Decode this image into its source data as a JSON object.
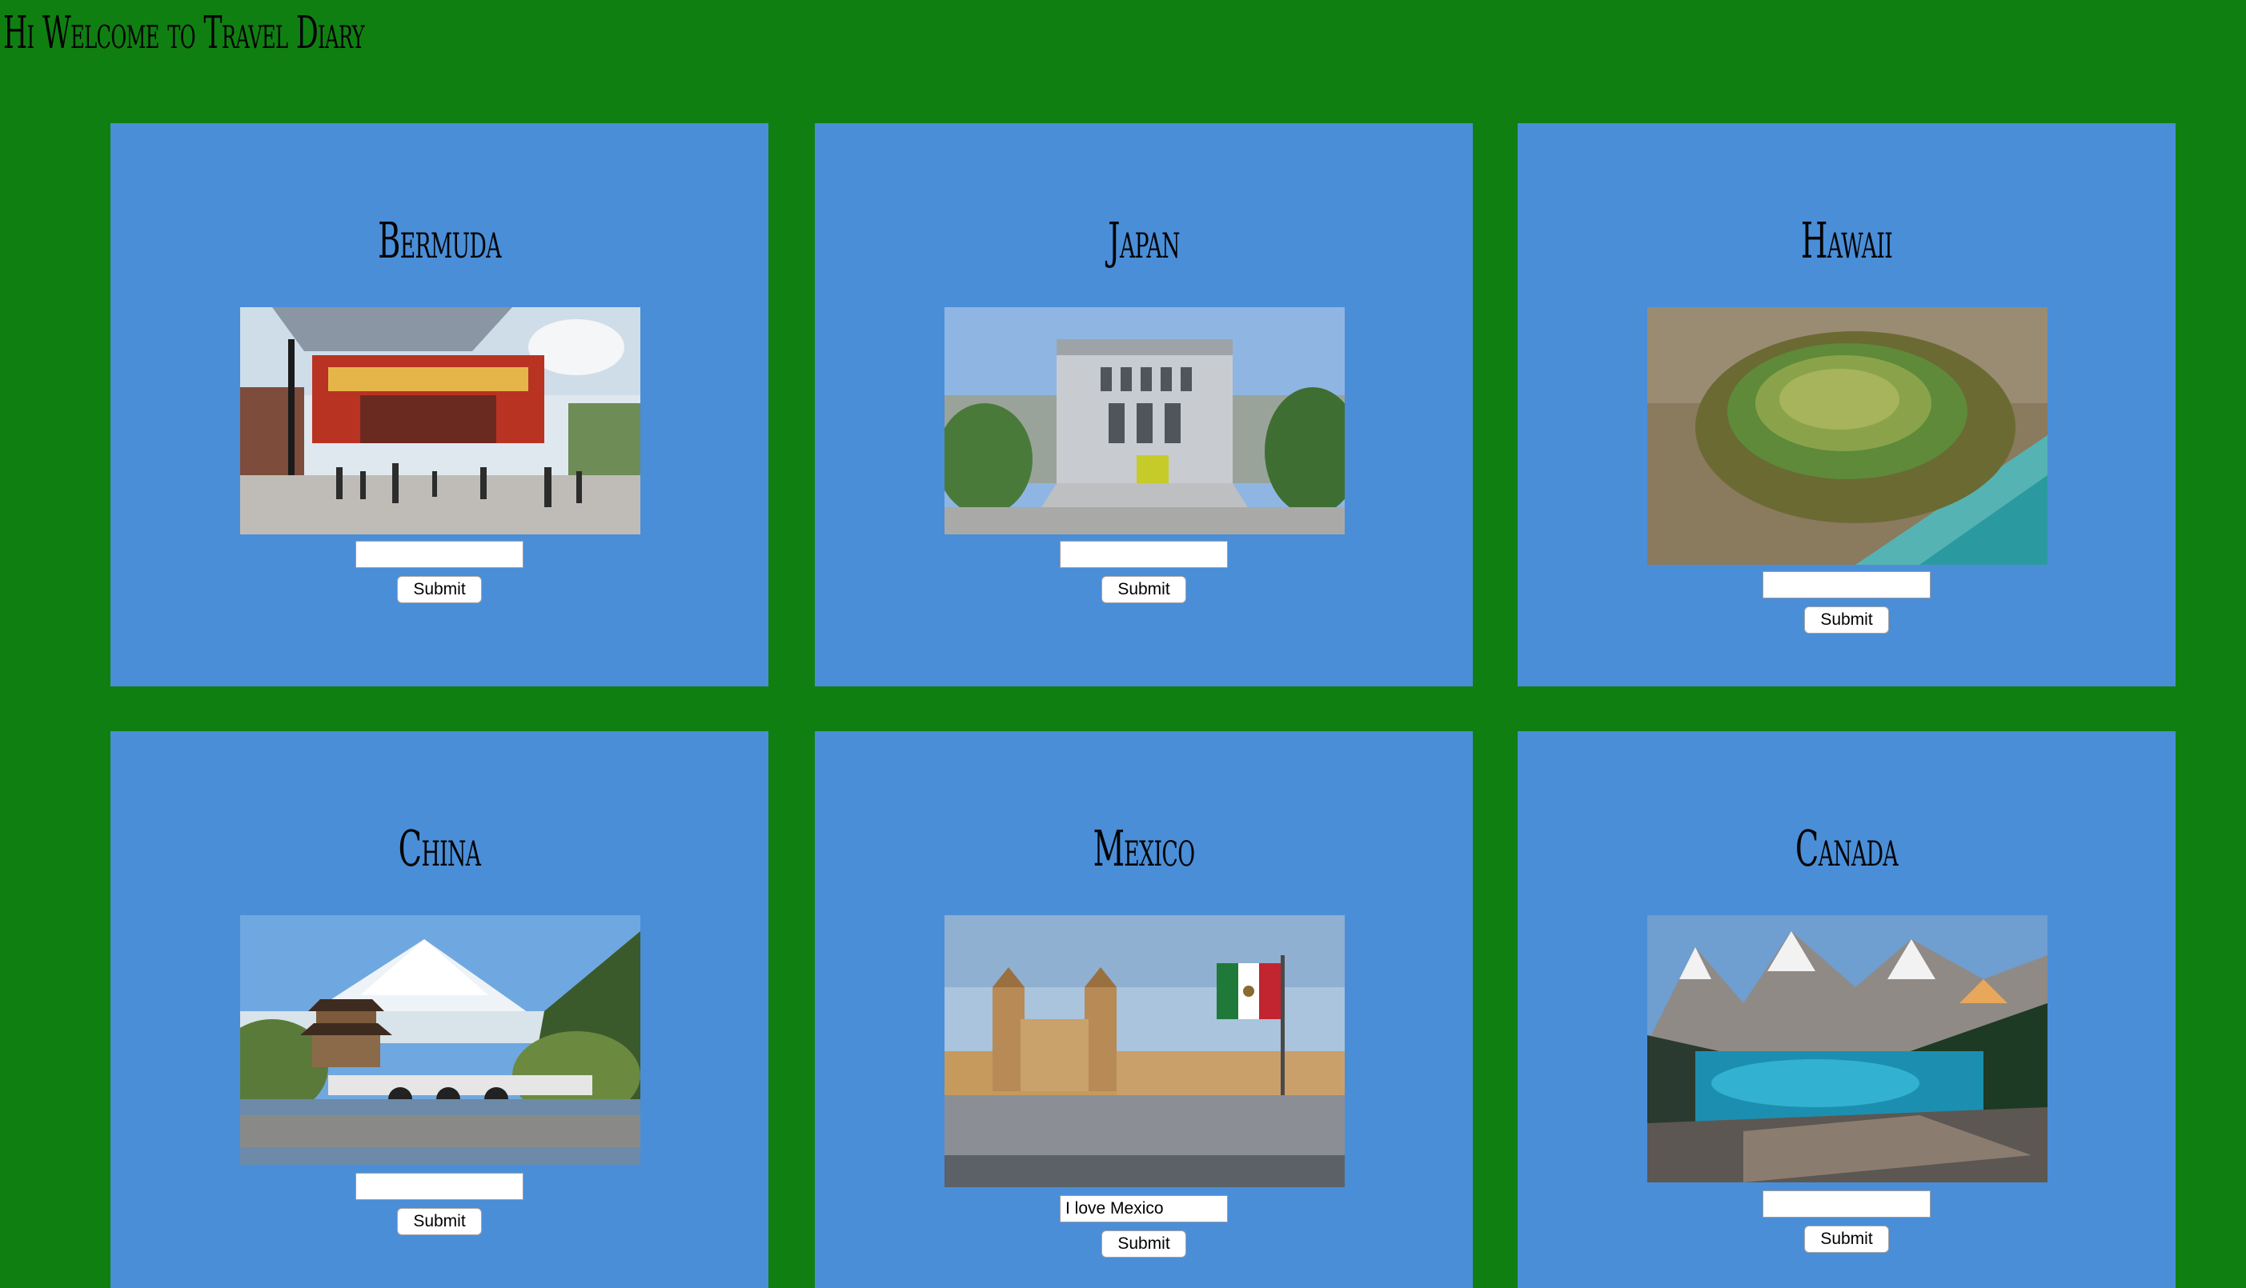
{
  "header": {
    "title": "Hi Welcome to Travel Diary"
  },
  "destinations": [
    {
      "name": "Bermuda",
      "photo_icon": "street-scene-photo",
      "input_value": "",
      "submit_label": "Submit"
    },
    {
      "name": "Japan",
      "photo_icon": "museum-building-photo",
      "input_value": "",
      "submit_label": "Submit"
    },
    {
      "name": "Hawaii",
      "photo_icon": "volcanic-crater-photo",
      "input_value": "",
      "submit_label": "Submit"
    },
    {
      "name": "China",
      "photo_icon": "pagoda-lake-photo",
      "input_value": "",
      "submit_label": "Submit"
    },
    {
      "name": "Mexico",
      "photo_icon": "cathedral-plaza-flag-photo",
      "input_value": "I love Mexico",
      "submit_label": "Submit"
    },
    {
      "name": "Canada",
      "photo_icon": "mountain-lake-photo",
      "input_value": "",
      "submit_label": "Submit"
    }
  ],
  "colors": {
    "page_background": "#107f12",
    "card_background": "#4a8ed8",
    "text": "#050505"
  }
}
